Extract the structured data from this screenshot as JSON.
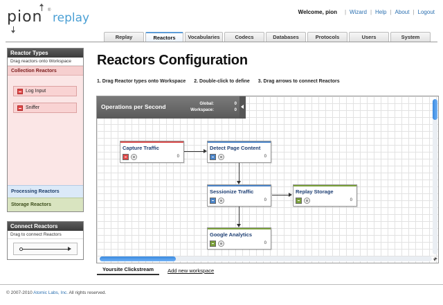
{
  "brand": {
    "logo_pion": "pion",
    "logo_replay": "replay",
    "logo_mark": "®"
  },
  "topbar": {
    "welcome": "Welcome, pion",
    "links": [
      "Wizard",
      "Help",
      "About",
      "Logout"
    ]
  },
  "nav": {
    "tabs": [
      "Replay",
      "Reactors",
      "Vocabularies",
      "Codecs",
      "Databases",
      "Protocols",
      "Users",
      "System"
    ],
    "active": "Reactors"
  },
  "sidebar": {
    "reactor_types_title": "Reactor Types",
    "reactor_types_hint": "Drag reactors onto Workspace",
    "collection_title": "Collection Reactors",
    "collection_items": [
      "Log Input",
      "Sniffer"
    ],
    "processing_title": "Processing Reactors",
    "storage_title": "Storage Reactors",
    "connect_title": "Connect Reactors",
    "connect_hint": "Drag to connect Reactors"
  },
  "main": {
    "title": "Reactors Configuration",
    "steps": [
      "1. Drag Reactor types onto Workspace",
      "2. Double-click to define",
      "3. Drag arrows to connect Reactors"
    ]
  },
  "ops": {
    "title": "Operations per Second",
    "global_label": "Global:",
    "global_value": "0",
    "workspace_label": "Workspace:",
    "workspace_value": "0"
  },
  "nodes": [
    {
      "title": "Capture Traffic",
      "category": "collection",
      "icon": "capture-icon",
      "count": "0"
    },
    {
      "title": "Detect Page Content",
      "category": "processing",
      "icon": "hash-icon",
      "count": "0"
    },
    {
      "title": "Sessionize Traffic",
      "category": "processing",
      "icon": "sessionize-icon",
      "count": "0"
    },
    {
      "title": "Replay Storage",
      "category": "storage",
      "icon": "storage-icon",
      "count": "0"
    },
    {
      "title": "Google Analytics",
      "category": "storage",
      "icon": "g-icon",
      "count": "0"
    }
  ],
  "workspace_tabs": {
    "active": "Yoursite Clickstream",
    "add": "Add new workspace"
  },
  "footer": {
    "prefix": "© 2007-2010 ",
    "company": "Atomic Labs, Inc.",
    "suffix": " All rights reserved."
  },
  "colors": {
    "accent": "#4a9fd4",
    "collection": "#d84a4a",
    "processing": "#4a84c8",
    "storage": "#7aa03a"
  }
}
